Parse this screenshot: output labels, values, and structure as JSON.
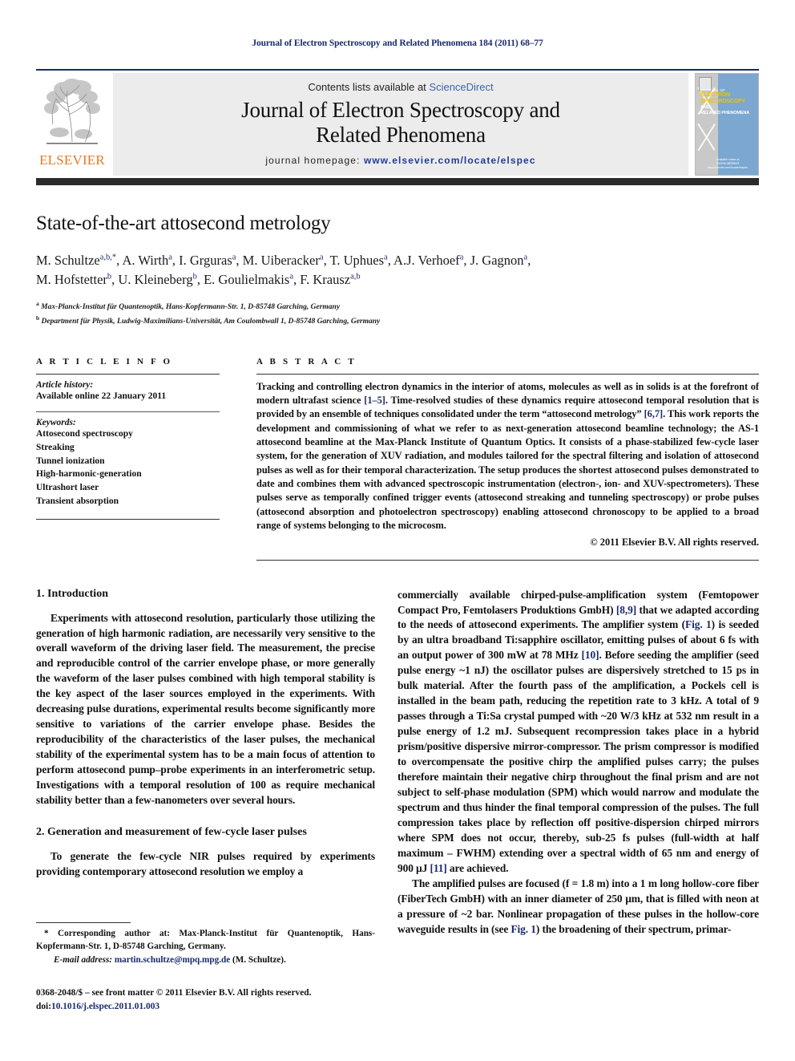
{
  "running_head": "Journal of Electron Spectroscopy and Related Phenomena 184 (2011) 68–77",
  "masthead": {
    "publisher_name": "ELSEVIER",
    "contents_prefix": "Contents lists available at ",
    "contents_link": "ScienceDirect",
    "journal_title_line1": "Journal of Electron Spectroscopy and",
    "journal_title_line2": "Related Phenomena",
    "homepage_label": "journal homepage:",
    "homepage_url": "www.elsevier.com/locate/elspec",
    "cover": {
      "line1": "JOURNAL OF",
      "line2": "ELECTRON",
      "line3": "SPECTROSCOPY",
      "line4": "AND",
      "line5": "RELATED PHENOMENA",
      "foot1": "Available online at",
      "foot2": "ScienceDirect",
      "foot3": "www.elsevier.com/locate/elspec"
    }
  },
  "article": {
    "title": "State-of-the-art attosecond metrology",
    "authors_line1": "M. Schultze",
    "authors_line1_sup": "a,b,*",
    "authors_rest1": ", A. Wirth",
    "authors_full_1": "M. Schultze a,b,*, A. Wirth a, I. Grguras a, M. Uiberacker a, T. Uphues a, A.J. Verhoef a, J. Gagnon a,",
    "authors_full_2": "M. Hofstetter b, U. Kleineberg b, E. Goulielmakis a, F. Krausz a,b",
    "affiliation_a": "Max-Planck-Institut für Quantenoptik, Hans-Kopfermann-Str. 1, D-85748 Garching, Germany",
    "affiliation_b": "Department für Physik, Ludwig-Maximilians-Universität, Am Coulombwall 1, D-85748 Garching, Germany",
    "affiliation_a_mark": "a",
    "affiliation_b_mark": "b"
  },
  "article_info": {
    "heading": "A R T I C L E   I N F O",
    "history_label": "Article history:",
    "history_value": "Available online 22 January 2011",
    "keywords_label": "Keywords:",
    "keywords": [
      "Attosecond spectroscopy",
      "Streaking",
      "Tunnel ionization",
      "High-harmonic-generation",
      "Ultrashort laser",
      "Transient absorption"
    ]
  },
  "abstract": {
    "heading": "A B S T R A C T",
    "part1": "Tracking and controlling electron dynamics in the interior of atoms, molecules as well as in solids is at the forefront of modern ultrafast science ",
    "ref1": "[1–5]",
    "part2": ". Time-resolved studies of these dynamics require attosecond temporal resolution that is provided by an ensemble of techniques consolidated under the term “attosecond metrology” ",
    "ref2": "[6,7]",
    "part3": ". This work reports the development and commissioning of what we refer to as next-generation attosecond beamline technology; the AS-1 attosecond beamline at the Max-Planck Institute of Quantum Optics. It consists of a phase-stabilized few-cycle laser system, for the generation of XUV radiation, and modules tailored for the spectral filtering and isolation of attosecond pulses as well as for their temporal characterization. The setup produces the shortest attosecond pulses demonstrated to date and combines them with advanced spectroscopic instrumentation (electron-, ion- and XUV-spectrometers). These pulses serve as temporally confined trigger events (attosecond streaking and tunneling spectroscopy) or probe pulses (attosecond absorption and photoelectron spectroscopy) enabling attosecond chronoscopy to be applied to a broad range of systems belonging to the microcosm.",
    "copyright": "© 2011 Elsevier B.V. All rights reserved."
  },
  "sections": {
    "intro_title": "1. Introduction",
    "intro_p1": "Experiments with attosecond resolution, particularly those utilizing the generation of high harmonic radiation, are necessarily very sensitive to the overall waveform of the driving laser field. The measurement, the precise and reproducible control of the carrier envelope phase, or more generally the waveform of the laser pulses combined with high temporal stability is the key aspect of the laser sources employed in the experiments. With decreasing pulse durations, experimental results become significantly more sensitive to variations of the carrier envelope phase. Besides the reproducibility of the characteristics of the laser pulses, the mechanical stability of the experimental system has to be a main focus of attention to perform attosecond pump–probe experiments in an interferometric setup. Investigations with a temporal resolution of 100 as require mechanical stability better than a few-nanometers over several hours.",
    "sec2_title": "2. Generation and measurement of few-cycle laser pulses",
    "sec2_p1": "To generate the few-cycle NIR pulses required by experiments providing contemporary attosecond resolution we employ a",
    "right_p1_a": "commercially available chirped-pulse-amplification system (Femtopower Compact Pro, Femtolasers Produktions GmbH) ",
    "right_ref_89": "[8,9]",
    "right_p1_b": " that we adapted according to the needs of attosecond experiments. The amplifier system (",
    "right_fig1_a": "Fig. 1",
    "right_p1_c": ") is seeded by an ultra broadband Ti:sapphire oscillator, emitting pulses of about 6 fs with an output power of 300 mW at 78 MHz ",
    "right_ref_10": "[10]",
    "right_p1_d": ". Before seeding the amplifier (seed pulse energy ~1 nJ) the oscillator pulses are dispersively stretched to 15 ps in bulk material. After the fourth pass of the amplification, a Pockels cell is installed in the beam path, reducing the repetition rate to 3 kHz. A total of 9 passes through a Ti:Sa crystal pumped with ~20 W/3 kHz at 532 nm result in a pulse energy of 1.2 mJ. Subsequent recompression takes place in a hybrid prism/positive dispersive mirror-compressor. The prism compressor is modified to overcompensate the positive chirp the amplified pulses carry; the pulses therefore maintain their negative chirp throughout the final prism and are not subject to self-phase modulation (SPM) which would narrow and modulate the spectrum and thus hinder the final temporal compression of the pulses. The full compression takes place by reflection off positive-dispersion chirped mirrors where SPM does not occur, thereby, sub-25 fs pulses (full-width at half maximum – FWHM) extending over a spectral width of 65 nm and energy of 900 µJ ",
    "right_ref_11": "[11]",
    "right_p1_e": " are achieved.",
    "right_p2_a": "The amplified pulses are focused (f = 1.8 m) into a 1 m long hollow-core fiber (FiberTech GmbH) with an inner diameter of 250 µm, that is filled with neon at a pressure of ~2 bar. Nonlinear propagation of these pulses in the hollow-core waveguide results in (see ",
    "right_fig1_b": "Fig. 1",
    "right_p2_b": ") the broadening of their spectrum, primar-"
  },
  "footnotes": {
    "corresponding": "* Corresponding author at: Max-Planck-Institut für Quantenoptik, Hans-Kopfermann-Str. 1, D-85748 Garching, Germany.",
    "email_label": "E-mail address:",
    "email_value": "martin.schultze@mpq.mpg.de",
    "email_suffix": " (M. Schultze).",
    "imprint_line1": "0368-2048/$ – see front matter © 2011 Elsevier B.V. All rights reserved.",
    "doi_label": "doi:",
    "doi_value": "10.1016/j.elspec.2011.01.003"
  },
  "colors": {
    "link_blue": "#1a2a6c",
    "elsevier_orange": "#E87722",
    "masthead_gray": "#ececec",
    "cover_blue": "#7ba7d0"
  }
}
